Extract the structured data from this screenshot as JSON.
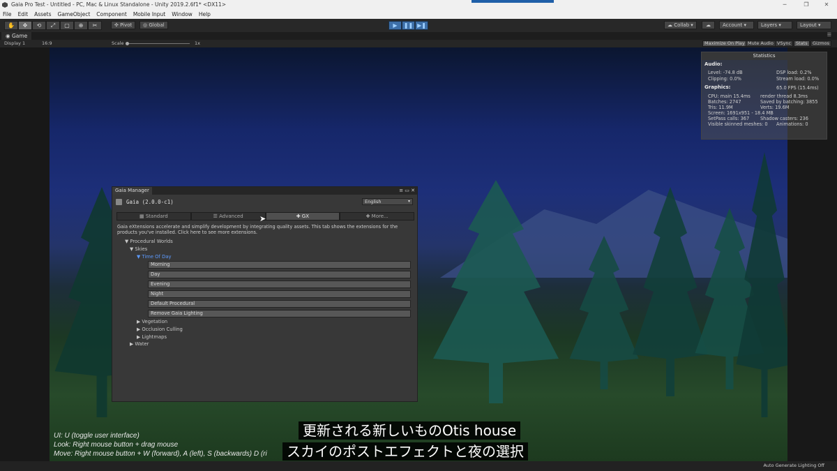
{
  "window": {
    "title": "Gaia Pro Test - Untitled - PC, Mac & Linux Standalone - Unity 2019.2.6f1* <DX11>",
    "minimize": "─",
    "maximize": "❐",
    "close": "✕"
  },
  "menu": [
    "File",
    "Edit",
    "Assets",
    "GameObject",
    "Component",
    "Mobile Input",
    "Window",
    "Help"
  ],
  "toolbar": {
    "tools": [
      "✋",
      "✥",
      "⟲",
      "⤢",
      "▢",
      "⊕",
      "✂"
    ],
    "pivot": "Pivot",
    "global": "Global",
    "play": "▶",
    "pause": "❚❚",
    "step": "▶❚",
    "collab": "Collab",
    "account": "Account",
    "layers": "Layers",
    "layout": "Layout"
  },
  "game": {
    "tab": "Game",
    "display": "Display 1",
    "aspect": "16:9",
    "scale_label": "Scale",
    "scale_value": "1x",
    "maximize_on_play": "Maximize On Play",
    "mute_audio": "Mute Audio",
    "vsync": "VSync",
    "stats": "Stats",
    "gizmos": "Gizmos"
  },
  "statistics": {
    "title": "Statistics",
    "audio_label": "Audio:",
    "level": "Level: -74.8 dB",
    "clipping": "Clipping: 0.0%",
    "dsp_load": "DSP load: 0.2%",
    "stream_load": "Stream load: 0.0%",
    "graphics_label": "Graphics:",
    "fps": "65.0 FPS (15.4ms)",
    "cpu": "CPU: main 15.4ms",
    "render_thread": "render thread 8.3ms",
    "batches": "Batches: 2747",
    "saved_batching": "Saved by batching: 3855",
    "tris": "Tris: 11.9M",
    "verts": "Verts: 19.6M",
    "screen": "Screen: 1691x951 - 18.4 MB",
    "setpass": "SetPass calls: 367",
    "shadow_casters": "Shadow casters: 236",
    "skinned": "Visible skinned meshes: 0",
    "animations": "Animations: 0"
  },
  "gaia": {
    "window_title": "Gaia Manager",
    "version": "Gaia (2.0.0-c1)",
    "language": "English",
    "tabs": [
      "Standard",
      "Advanced",
      "GX",
      "More..."
    ],
    "description": "Gaia eXtensions accelerate and simplify development by integrating quality assets. This tab shows the extensions for the products you've installed. Click here to see more extensions.",
    "tree": {
      "procedural_worlds": "▼ Procedural Worlds",
      "skies": "▼ Skies",
      "time_of_day": "▼ Time Of Day",
      "vegetation": "▶ Vegetation",
      "occlusion_culling": "▶ Occlusion Culling",
      "lightmaps": "▶ Lightmaps",
      "water": "▶ Water"
    },
    "buttons": [
      "Morning",
      "Day",
      "Evening",
      "Night",
      "Default Procedural",
      "Remove Gaia Lighting"
    ]
  },
  "help": {
    "line1": "UI: U (toggle user interface)",
    "line2": "Look: Right mouse button + drag mouse",
    "line3": "Move: Right mouse button + W (forward), A (left), S (backwards) D (ri"
  },
  "subtitles": {
    "line1": "更新される新しいものOtis house",
    "line2": "スカイのポストエフェクトと夜の選択"
  },
  "status": {
    "auto_lighting": "Auto Generate Lighting Off"
  }
}
